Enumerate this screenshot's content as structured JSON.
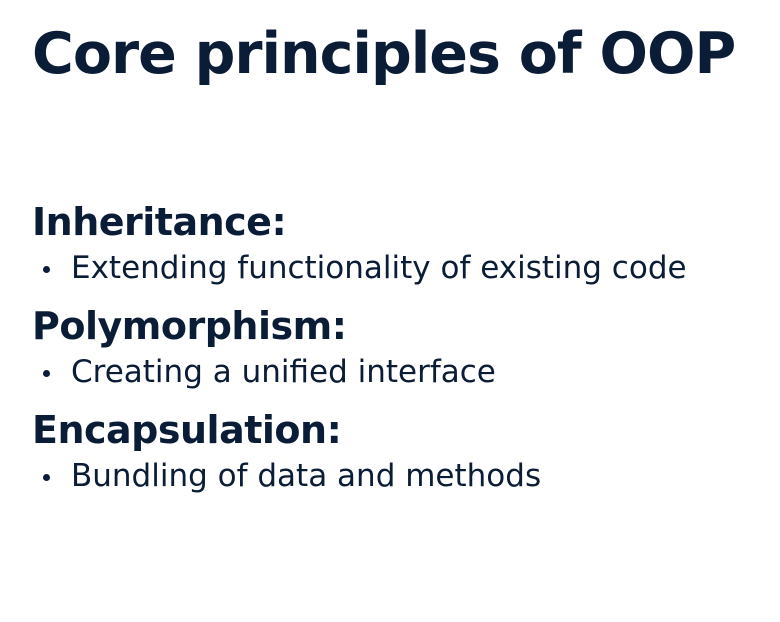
{
  "slide": {
    "title": "Core principles of OOP",
    "sections": [
      {
        "heading": "Inheritance:",
        "bullets": [
          "Extending functionality of existing code"
        ]
      },
      {
        "heading": "Polymorphism:",
        "bullets": [
          "Creating a unified interface"
        ]
      },
      {
        "heading": "Encapsulation:",
        "bullets": [
          "Bundling of data and methods"
        ]
      }
    ],
    "colors": {
      "text": "#0b1d36",
      "background": "#ffffff"
    }
  }
}
